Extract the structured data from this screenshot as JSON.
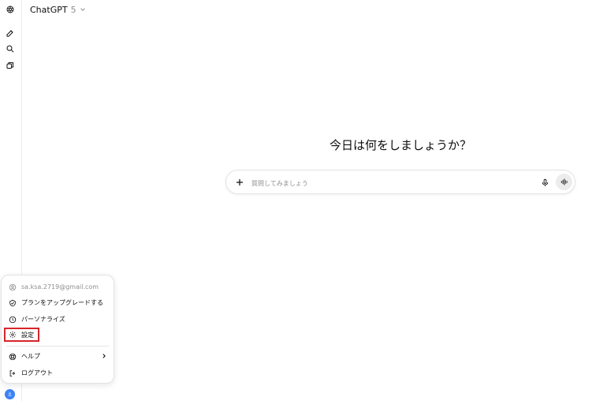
{
  "header": {
    "model_name": "ChatGPT",
    "model_version": "5"
  },
  "main": {
    "headline": "今日は何をしましょうか？",
    "composer_placeholder": "質問してみましょう"
  },
  "account_menu": {
    "email": "sa.ksa.2719@gmail.com",
    "items": [
      {
        "label": "プランをアップグレードする",
        "icon": "upgrade-icon"
      },
      {
        "label": "パーソナライズ",
        "icon": "personalize-icon"
      },
      {
        "label": "設定",
        "icon": "gear-icon",
        "highlighted": true
      },
      {
        "label": "ヘルプ",
        "icon": "help-icon",
        "has_submenu": true
      },
      {
        "label": "ログアウト",
        "icon": "logout-icon"
      }
    ]
  },
  "avatar_initial": "え",
  "colors": {
    "highlight_border": "#d7262b",
    "avatar_bg": "#3b82f6",
    "voice_button_bg": "#ececec"
  }
}
